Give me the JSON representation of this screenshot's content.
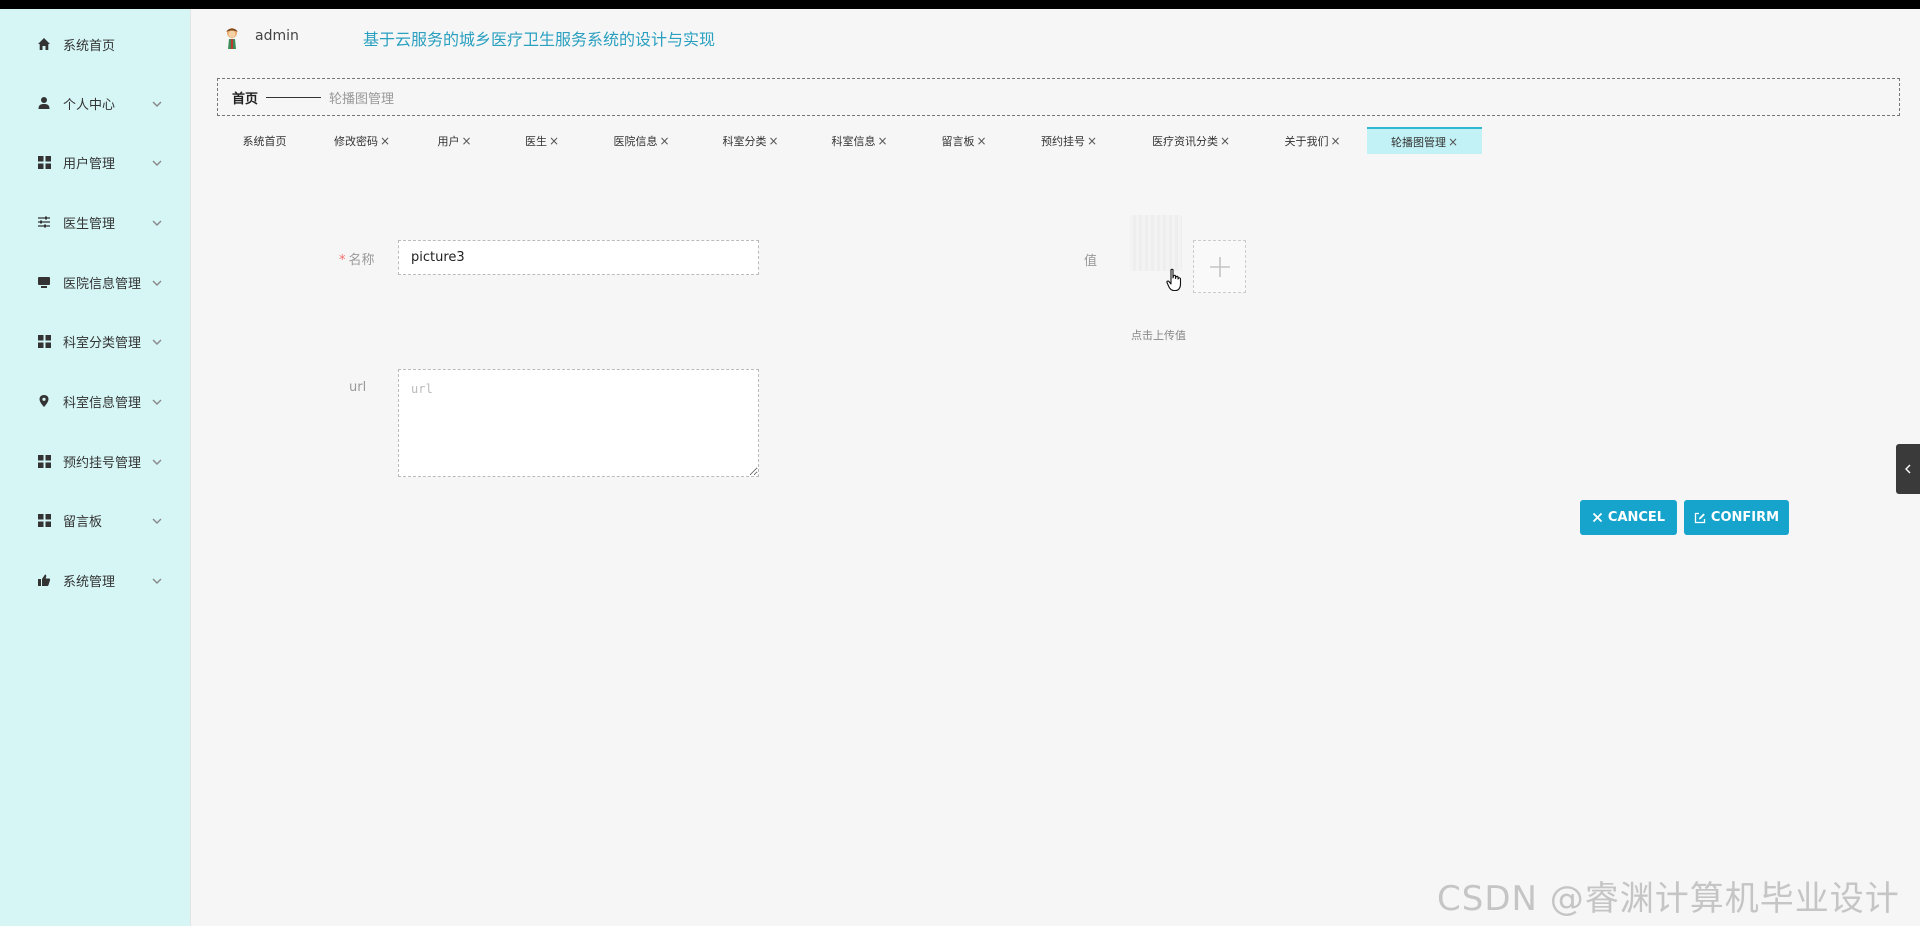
{
  "header": {
    "username": "admin",
    "app_title": "基于云服务的城乡医疗卫生服务系统的设计与实现"
  },
  "sidebar": {
    "items": [
      {
        "label": "系统首页",
        "icon": "home-icon",
        "has_submenu": false
      },
      {
        "label": "个人中心",
        "icon": "user-icon",
        "has_submenu": true
      },
      {
        "label": "用户管理",
        "icon": "grid-icon",
        "has_submenu": true
      },
      {
        "label": "医生管理",
        "icon": "sliders-icon",
        "has_submenu": true
      },
      {
        "label": "医院信息管理",
        "icon": "monitor-icon",
        "has_submenu": true
      },
      {
        "label": "科室分类管理",
        "icon": "grid-icon",
        "has_submenu": true
      },
      {
        "label": "科室信息管理",
        "icon": "location-pin-icon",
        "has_submenu": true
      },
      {
        "label": "预约挂号管理",
        "icon": "grid-icon",
        "has_submenu": true
      },
      {
        "label": "留言板",
        "icon": "grid-icon",
        "has_submenu": true
      },
      {
        "label": "系统管理",
        "icon": "thumbs-up-icon",
        "has_submenu": true
      }
    ]
  },
  "breadcrumb": {
    "home": "首页",
    "current": "轮播图管理"
  },
  "tabs": [
    {
      "label": "系统首页",
      "closable": false,
      "active": false
    },
    {
      "label": "修改密码",
      "closable": true,
      "active": false
    },
    {
      "label": "用户",
      "closable": true,
      "active": false
    },
    {
      "label": "医生",
      "closable": true,
      "active": false
    },
    {
      "label": "医院信息",
      "closable": true,
      "active": false
    },
    {
      "label": "科室分类",
      "closable": true,
      "active": false
    },
    {
      "label": "科室信息",
      "closable": true,
      "active": false
    },
    {
      "label": "留言板",
      "closable": true,
      "active": false
    },
    {
      "label": "预约挂号",
      "closable": true,
      "active": false
    },
    {
      "label": "医疗资讯分类",
      "closable": true,
      "active": false
    },
    {
      "label": "关于我们",
      "closable": true,
      "active": false
    },
    {
      "label": "轮播图管理",
      "closable": true,
      "active": true
    }
  ],
  "tab_close_glyph": "×",
  "form": {
    "name_label": "名称",
    "name_required_mark": "*",
    "name_value": "picture3",
    "value_label": "值",
    "upload_hint": "点击上传值",
    "url_label": "url",
    "url_placeholder": "url",
    "url_value": ""
  },
  "buttons": {
    "cancel": "CANCEL",
    "confirm": "CONFIRM"
  },
  "colors": {
    "sidebar_bg": "#d6f6f6",
    "accent": "#17a4cc",
    "title": "#2aa0c0",
    "active_tab": "#c2f2f5"
  },
  "watermark": "CSDN @睿渊计算机毕业设计"
}
